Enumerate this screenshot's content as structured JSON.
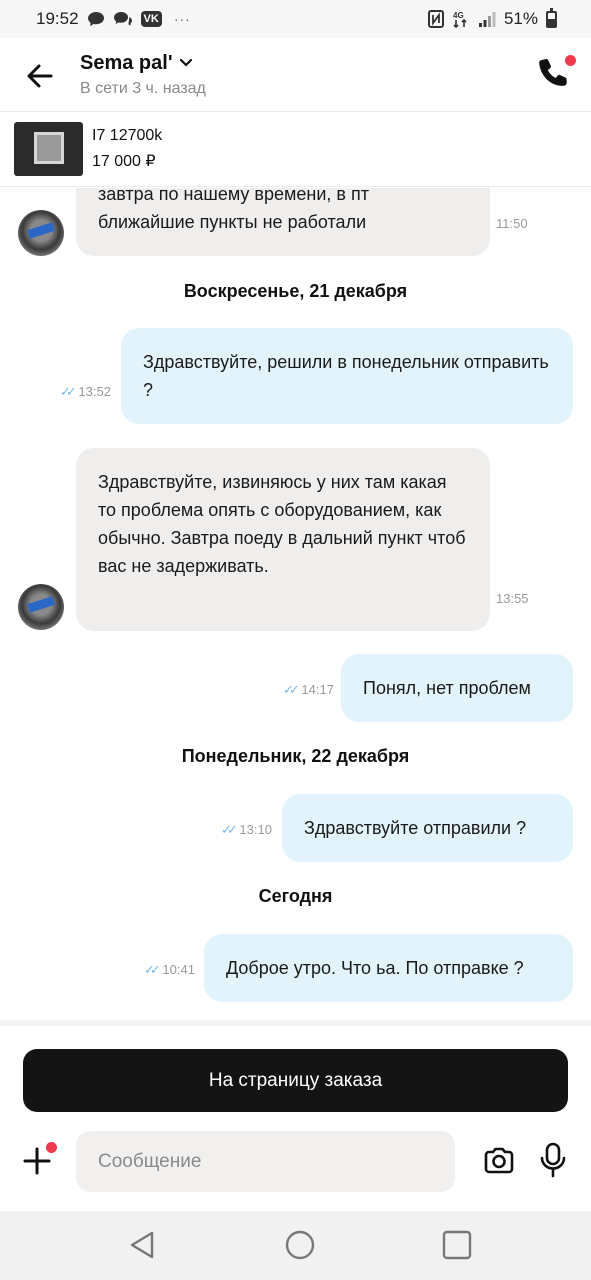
{
  "status_bar": {
    "time": "19:52",
    "battery": "51%",
    "network": "4G"
  },
  "header": {
    "contact_name": "Sema pal'",
    "online_status": "В сети 3 ч. назад",
    "icons": {
      "back": "arrow-left-icon",
      "call": "phone-icon",
      "dropdown": "chevron-down-icon"
    }
  },
  "product": {
    "title": "I7 12700k",
    "price": "17 000 ₽"
  },
  "chat": {
    "messages": [
      {
        "direction": "incoming",
        "text": "завтра по нашему времени, в пт ближайшие пункты не работали",
        "time": "11:50"
      },
      {
        "type": "date",
        "text": "Воскресенье, 21 декабря"
      },
      {
        "direction": "outgoing",
        "text": "Здравствуйте, решили в понедельник отправить ?",
        "time": "13:52",
        "read": true
      },
      {
        "direction": "incoming",
        "text": "Здравствуйте, извиняюсь у них там какая то проблема опять с оборудованием, как обычно. Завтра поеду в дальний пункт чтоб вас не задерживать.",
        "time": "13:55"
      },
      {
        "direction": "outgoing",
        "text": "Понял, нет проблем",
        "time": "14:17",
        "read": true
      },
      {
        "type": "date",
        "text": "Понедельник, 22 декабря"
      },
      {
        "direction": "outgoing",
        "text": "Здравствуйте отправили ?",
        "time": "13:10",
        "read": true
      },
      {
        "type": "date",
        "text": "Сегодня"
      },
      {
        "direction": "outgoing",
        "text": "Доброе утро. Что ьа. По отправке ?",
        "time": "10:41",
        "read": true
      }
    ]
  },
  "order_button": {
    "label": "На страницу заказа"
  },
  "composer": {
    "placeholder": "Сообщение"
  },
  "colors": {
    "accent_dot": "#f23a4f",
    "outgoing_bubble": "#e3f3fc",
    "incoming_bubble": "#f0eeec",
    "button": "#141414",
    "read_ticks": "#79b8e8"
  }
}
